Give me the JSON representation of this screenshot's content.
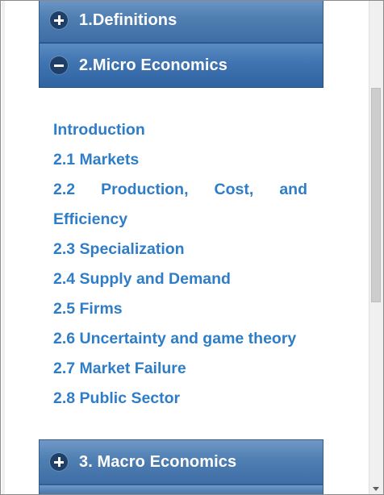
{
  "accordion": {
    "sections": [
      {
        "title": "1.Definitions",
        "state": "collapsed"
      },
      {
        "title": "2.Micro Economics",
        "state": "expanded"
      },
      {
        "title": "3. Macro Economics",
        "state": "collapsed"
      }
    ],
    "micro_links": [
      "Introduction",
      "2.1 Markets",
      "2.2 Production, Cost, and Efficiency",
      "2.3 Specialization",
      "2.4 Supply and Demand",
      "2.5 Firms",
      "2.6 Uncertainty and game theory",
      "2.7 Market Failure",
      "2.8 Public Sector"
    ],
    "micro_link_2_2_words": [
      "2.2",
      "Production,",
      "Cost,",
      "and"
    ],
    "micro_link_2_2_wrap": "Efficiency"
  },
  "icons": {
    "expand": "plus-circle-icon",
    "collapse": "minus-circle-icon",
    "scroll_down": "scroll-down-arrow-icon"
  },
  "colors": {
    "header_blue": "#4f7eb2",
    "link_blue": "#2f7dc6",
    "icon_dark": "#1f3f66"
  }
}
